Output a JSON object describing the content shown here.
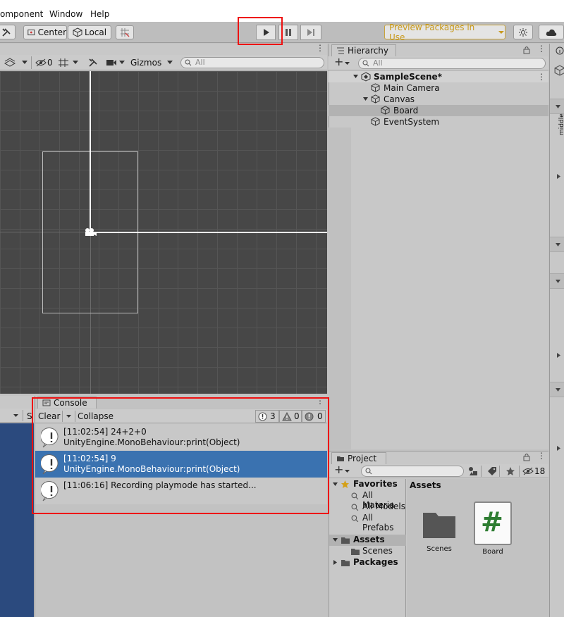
{
  "menu": {
    "items": [
      "omponent",
      "Window",
      "Help"
    ]
  },
  "toolbar": {
    "center_label": "Center",
    "local_label": "Local",
    "preview_label": "Preview Packages in Use"
  },
  "scene": {
    "eye_count": "0",
    "gizmos_label": "Gizmos",
    "search_placeholder": "All"
  },
  "hierarchy": {
    "tab_label": "Hierarchy",
    "search_placeholder": "All",
    "items": [
      {
        "label": "SampleScene*"
      },
      {
        "label": "Main Camera"
      },
      {
        "label": "Canvas"
      },
      {
        "label": "Board"
      },
      {
        "label": "EventSystem"
      }
    ]
  },
  "inspector": {
    "side_label": "middle"
  },
  "console": {
    "tab_label": "Console",
    "clear_label": "Clear",
    "collapse_label": "Collapse",
    "partial_s": "S",
    "counts": {
      "info": "3",
      "warn": "0",
      "error": "0"
    },
    "logs": [
      {
        "line1": "[11:02:54] 24+2+0",
        "line2": "UnityEngine.MonoBehaviour:print(Object)"
      },
      {
        "line1": "[11:02:54] 9",
        "line2": "UnityEngine.MonoBehaviour:print(Object)"
      },
      {
        "line1": "[11:06:16] Recording playmode has started..."
      }
    ]
  },
  "project": {
    "tab_label": "Project",
    "hidden_count": "18",
    "favorites_label": "Favorites",
    "favorites": [
      "All Materia",
      "All Models",
      "All Prefabs"
    ],
    "assets_label": "Assets",
    "assets_children": [
      "Scenes"
    ],
    "packages_label": "Packages",
    "header": "Assets",
    "grid": [
      {
        "label": "Scenes"
      },
      {
        "label": "Board"
      }
    ]
  },
  "colors": {
    "selection": "#3a72b0",
    "highlight_red": "#ee1111",
    "scene_bg": "#474747",
    "preview_text": "#c89a1e"
  }
}
